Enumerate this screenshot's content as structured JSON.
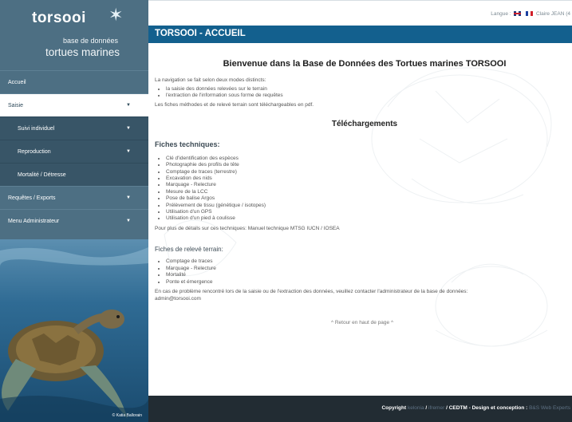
{
  "sidebar": {
    "logo_name": "torsooi",
    "logo_line1": "base de données",
    "logo_line2": "tortues marines",
    "items": [
      {
        "label": "Accueil",
        "active": false
      },
      {
        "label": "Saisie",
        "active": true
      },
      {
        "label": "Suivi individuel",
        "sub": true
      },
      {
        "label": "Reproduction",
        "sub": true
      },
      {
        "label": "Mortalité / Détresse",
        "sub": true
      },
      {
        "label": "Requêtes / Exports"
      },
      {
        "label": "Menu Administrateur"
      }
    ],
    "photo_credit": "© Katia Ballorain"
  },
  "topbar": {
    "lang_label": "Langue :",
    "user": "Claire JEAN (4"
  },
  "page_title": "TORSOOI - ACCUEIL",
  "main": {
    "welcome": "Bienvenue dans la Base de Données des Tortues marines TORSOOI",
    "intro": "La navigation se fait selon deux modes distincts:",
    "modes": [
      "la saisie des données relevées sur le terrain",
      "l'extraction de l'information sous forme de requêtes"
    ],
    "pdf_note": "Les fiches méthodes et de relevé terrain sont téléchargeables en pdf.",
    "downloads_title": "Téléchargements",
    "tech_title": "Fiches techniques:",
    "tech_items": [
      "Clé d'identification des espèces",
      "Photographie des profils de tête",
      "Comptage de traces (terrestre)",
      "Excavation des nids",
      "Marquage - Relecture",
      "Mesure de la LCC",
      "Pose de balise Argos",
      "Prélèvement de tissu (génétique / isotopes)",
      "Utilisation d'un GPS",
      "Utilisation d'un pied à coulisse"
    ],
    "tech_more": "Pour plus de détails sur ces techniques: Manuel technique MTSG IUCN / IOSEA",
    "field_title": "Fiches de relevé terrain:",
    "field_items": [
      "Comptage de traces",
      "Marquage - Relecture",
      "Mortalité",
      "Ponte et émergence"
    ],
    "contact": "En cas de problème rencontré lors de la saisie ou de l'extraction des données, veuillez contacter l'administrateur de la base de données:",
    "email": "admin@torsooi.com",
    "back_top": "^ Retour en haut de page ^"
  },
  "footer": {
    "copyright": "Copyright",
    "kelonia": "kelonia",
    "sep1": "/",
    "ifremer": "ifremer",
    "rest": "/ CEDTM - Design et conception :",
    "credit": "B&S Web Experts"
  },
  "colors": {
    "sidebar": "#4d6f83",
    "titlebar": "#13608e",
    "footer": "#222c33"
  }
}
